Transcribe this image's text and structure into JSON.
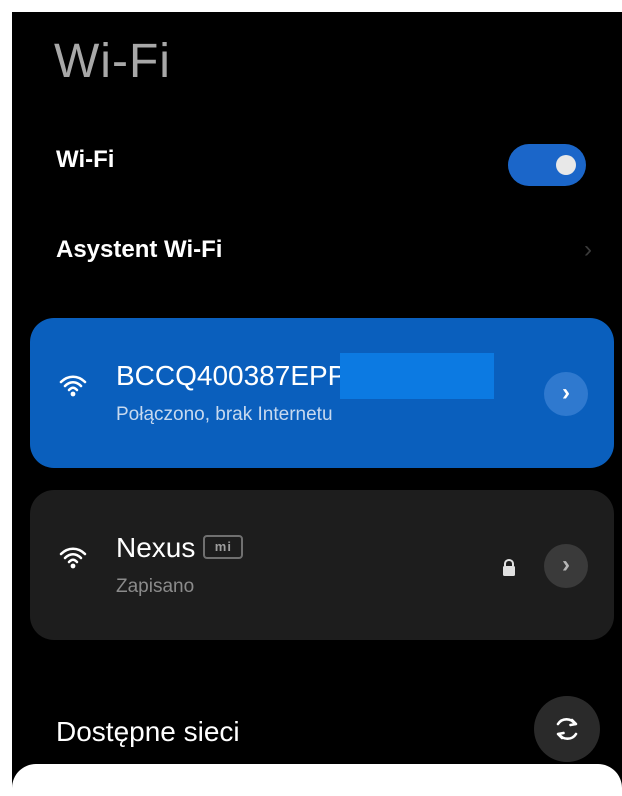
{
  "page": {
    "title": "Wi-Fi"
  },
  "settings": {
    "wifi_label": "Wi-Fi",
    "wifi_enabled": true,
    "assistant_label": "Asystent Wi-Fi"
  },
  "networks": [
    {
      "name": "BCCQ400387EPP",
      "status": "Połączono, brak Internetu",
      "icon": "wifi-icon",
      "action_icon": "chevron-right-icon"
    },
    {
      "name": "Nexus",
      "badge": "mi",
      "status": "Zapisano",
      "icon": "wifi-icon",
      "secondary_icon": "lock-icon",
      "action_icon": "chevron-right-icon"
    }
  ],
  "available_networks": {
    "title": "Dostępne sieci",
    "refresh_icon": "refresh-icon"
  },
  "colors": {
    "background": "#000000",
    "accent": "#1b66c9",
    "connected_card": "#0a5fbd",
    "saved_card": "#1d1d1d",
    "sheet": "#ffffff"
  }
}
